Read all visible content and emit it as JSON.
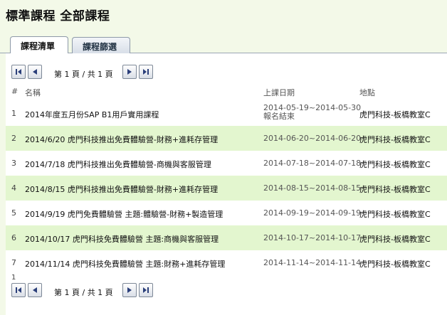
{
  "page": {
    "title": "標準課程 全部課程"
  },
  "tabs": [
    {
      "label": "課程清單",
      "active": true
    },
    {
      "label": "課程篩選",
      "active": false
    }
  ],
  "pager": {
    "info": "第 1 頁 / 共 1 頁",
    "icons": [
      "first-page-icon",
      "prev-page-icon",
      "next-page-icon",
      "last-page-icon"
    ]
  },
  "table": {
    "headers": {
      "num": "#",
      "name": "名稱",
      "date": "上課日期",
      "location": "地點"
    },
    "rows": [
      {
        "num": "1",
        "name": "2014年度五月份SAP B1用戶實用課程",
        "date_line1": "2014-05-19~2014-05-30",
        "date_line2": "報名結束",
        "location": "虎門科技-板橋教室C"
      },
      {
        "num": "2",
        "name": "2014/6/20 虎門科技推出免費體驗營-財務+進耗存管理",
        "date_line1": "2014-06-20~2014-06-20",
        "date_line2": "",
        "location": "虎門科技-板橋教室C"
      },
      {
        "num": "3",
        "name": "2014/7/18 虎門科技推出免費體驗營-商機與客服管理",
        "date_line1": "2014-07-18~2014-07-18",
        "date_line2": "",
        "location": "虎門科技-板橋教室C"
      },
      {
        "num": "4",
        "name": "2014/8/15 虎門科技推出免費體驗營-財務+進耗存管理",
        "date_line1": "2014-08-15~2014-08-15",
        "date_line2": "",
        "location": "虎門科技-板橋教室C"
      },
      {
        "num": "5",
        "name": "2014/9/19 虎門免費體驗營 主題:體驗營-財務+製造管理",
        "date_line1": "2014-09-19~2014-09-19",
        "date_line2": "",
        "location": "虎門科技-板橋教室C"
      },
      {
        "num": "6",
        "name": "2014/10/17 虎門科技免費體驗營 主題:商機與客服管理",
        "date_line1": "2014-10-17~2014-10-17",
        "date_line2": "",
        "location": "虎門科技-板橋教室C"
      },
      {
        "num": "7",
        "name": "2014/11/14 虎門科技免費體驗營 主題:財務+進耗存管理",
        "date_line1": "2014-11-14~2014-11-14",
        "date_line2": "",
        "location": "虎門科技-板橋教室C"
      }
    ],
    "footer_count": "1"
  },
  "colors": {
    "background": "#f3f9e8",
    "alt_row": "#e3f6cf",
    "panel": "#ffffff"
  }
}
